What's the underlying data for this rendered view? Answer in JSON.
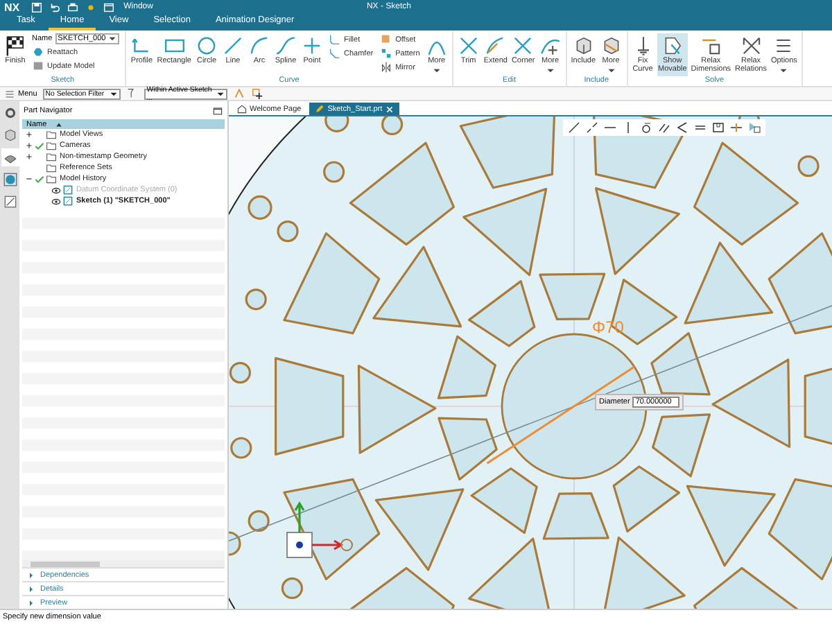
{
  "title_bar": {
    "logo": "NX",
    "window_menu": "Window",
    "title": "NX - Sketch"
  },
  "menu_tabs": [
    {
      "label": "Task",
      "selected": false
    },
    {
      "label": "Home",
      "selected": true
    },
    {
      "label": "View",
      "selected": false
    },
    {
      "label": "Selection",
      "selected": false
    },
    {
      "label": "Animation Designer",
      "selected": false
    }
  ],
  "ribbon_groups": [
    {
      "label": "Sketch",
      "items": [
        {
          "kind": "large",
          "label": "Finish",
          "on": false
        },
        {
          "kind": "stack",
          "items": [
            {
              "kind": "field",
              "label": "Name",
              "value": "SKETCH_000"
            },
            {
              "kind": "small",
              "label": "Reattach"
            },
            {
              "kind": "small",
              "label": "Update Model"
            }
          ]
        }
      ]
    },
    {
      "label": "Curve",
      "items": [
        {
          "kind": "large",
          "label": "Profile",
          "on": false
        },
        {
          "kind": "large",
          "label": "Rectangle",
          "on": false
        },
        {
          "kind": "large",
          "label": "Circle",
          "on": false
        },
        {
          "kind": "large",
          "label": "Line",
          "on": false
        },
        {
          "kind": "large",
          "label": "Arc",
          "on": false
        },
        {
          "kind": "large",
          "label": "Spline",
          "on": false
        },
        {
          "kind": "large",
          "label": "Point",
          "on": false
        },
        {
          "kind": "stack",
          "items": [
            {
              "kind": "small",
              "label": "Fillet"
            },
            {
              "kind": "small",
              "label": "Chamfer"
            }
          ]
        },
        {
          "kind": "stack",
          "items": [
            {
              "kind": "small",
              "label": "Offset"
            },
            {
              "kind": "small",
              "label": "Pattern"
            },
            {
              "kind": "small",
              "label": "Mirror"
            }
          ]
        },
        {
          "kind": "large",
          "label": "More",
          "on": false,
          "dropdown": true
        }
      ]
    },
    {
      "label": "Edit",
      "items": [
        {
          "kind": "large",
          "label": "Trim",
          "on": false
        },
        {
          "kind": "large",
          "label": "Extend",
          "on": false
        },
        {
          "kind": "large",
          "label": "Corner",
          "on": false
        },
        {
          "kind": "large",
          "label": "More",
          "on": false,
          "dropdown": true
        }
      ]
    },
    {
      "label": "Include",
      "items": [
        {
          "kind": "large",
          "label": "Include",
          "on": false
        },
        {
          "kind": "large",
          "label": "More",
          "on": false,
          "dropdown": true
        }
      ]
    },
    {
      "label": "Solve",
      "items": [
        {
          "kind": "large",
          "label": "Fix Curve",
          "on": false
        },
        {
          "kind": "large",
          "label": "Show Movable",
          "on": true
        },
        {
          "kind": "large",
          "label": "Relax Dimensions",
          "on": false
        },
        {
          "kind": "large",
          "label": "Relax Relations",
          "on": false
        },
        {
          "kind": "large",
          "label": "Options",
          "on": false,
          "dropdown": true
        }
      ]
    }
  ],
  "toolbar": {
    "menu": "Menu",
    "selection_filter": "No Selection Filter",
    "scope": "Within Active Sketch ..."
  },
  "navigator": {
    "title": "Part Navigator",
    "column": "Name",
    "tree": [
      {
        "label": "Model Views",
        "expanded": false,
        "checked": false
      },
      {
        "label": "Cameras",
        "expanded": false,
        "checked": true
      },
      {
        "label": "Non-timestamp Geometry",
        "expanded": false,
        "checked": false
      },
      {
        "label": "Reference Sets",
        "checked": false
      },
      {
        "label": "Model History",
        "expanded": true,
        "checked": true,
        "children": [
          {
            "label": "Datum Coordinate System (0)",
            "disabled": true,
            "active": false
          },
          {
            "label": "Sketch (1) \"SKETCH_000\"",
            "disabled": false,
            "active": true
          }
        ]
      }
    ],
    "sections": [
      {
        "label": "Dependencies",
        "expanded": false
      },
      {
        "label": "Details",
        "expanded": false
      },
      {
        "label": "Preview",
        "expanded": false
      }
    ]
  },
  "document_tabs": [
    {
      "label": "Welcome Page",
      "selected": false
    },
    {
      "label": "Sketch_Start.prt",
      "selected": true
    }
  ],
  "dimension": {
    "label": "Φ70",
    "field_label": "Diameter",
    "value": "70.000000"
  },
  "status_bar": "Specify new dimension value"
}
